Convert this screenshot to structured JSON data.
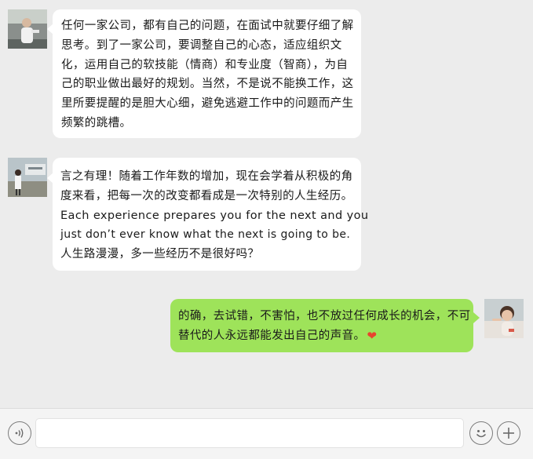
{
  "messages": [
    {
      "side": "left",
      "avatar": "man-standing-avatar",
      "lines": [
        "任何一家公司，都有自己的问题，在面试中就要仔细了解",
        "思考。到了一家公司，要调整自己的心态，适应组织文",
        "化，运用自己的软技能（情商）和专业度（智商），为自",
        "己的职业做出最好的规划。当然，不是说不能换工作，这",
        "里所要提醒的是胆大心细，避免逃避工作中的问题而产生",
        "频繁的跳槽。"
      ]
    },
    {
      "side": "left",
      "avatar": "woman-outdoor-avatar",
      "lines": [
        "言之有理！随着工作年数的增加，现在会学着从积极的角",
        "度来看，把每一次的改变都看成是一次特别的人生经历。",
        "Each experience prepares you for the next and you",
        "just don’t ever know what the next is going to be.",
        "人生路漫漫，多一些经历不是很好吗？"
      ]
    },
    {
      "side": "right",
      "avatar": "child-avatar",
      "lines": [
        "的确，去试错，不害怕，也不放过任何成长的机会，不可",
        "替代的人永远都能发出自己的声音。"
      ],
      "emoji": "heart-emoji",
      "emoji_char": "❤"
    }
  ],
  "input": {
    "value": "",
    "voice_icon": "voice-icon",
    "emoji_icon": "emoji-icon",
    "plus_icon": "plus-icon"
  },
  "colors": {
    "background": "#ececec",
    "bubble_left": "#ffffff",
    "bubble_right": "#9ee35a",
    "heart": "#e8432f"
  }
}
